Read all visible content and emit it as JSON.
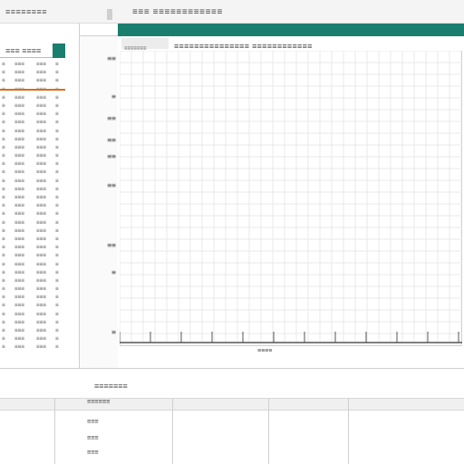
{
  "titlebar": {
    "left_text": "≡≡≡≡≡≡≡≡",
    "center_text": "≡≡≡ ≡≡≡≡≡≡≡≡≡≡≡≡"
  },
  "left_table": {
    "header_label": "≡≡≡ ≡≡≡≡",
    "rows": [
      [
        "≡",
        "≡≡≡",
        "≡≡≡",
        "≡"
      ],
      [
        "≡",
        "≡≡≡",
        "≡≡≡",
        "≡"
      ],
      [
        "≡",
        "≡≡≡",
        "≡≡≡",
        "≡"
      ],
      [
        "≡",
        "≡≡≡",
        "≡≡≡",
        "≡"
      ],
      [
        "≡",
        "≡≡≡",
        "≡≡≡",
        "≡"
      ],
      [
        "≡",
        "≡≡≡",
        "≡≡≡",
        "≡"
      ],
      [
        "≡",
        "≡≡≡",
        "≡≡≡",
        "≡"
      ],
      [
        "≡",
        "≡≡≡",
        "≡≡≡",
        "≡"
      ],
      [
        "≡",
        "≡≡≡",
        "≡≡≡",
        "≡"
      ],
      [
        "≡",
        "≡≡≡",
        "≡≡≡",
        "≡"
      ],
      [
        "≡",
        "≡≡≡",
        "≡≡≡",
        "≡"
      ],
      [
        "≡",
        "≡≡≡",
        "≡≡≡",
        "≡"
      ],
      [
        "≡",
        "≡≡≡",
        "≡≡≡",
        "≡"
      ],
      [
        "≡",
        "≡≡≡",
        "≡≡≡",
        "≡"
      ],
      [
        "≡",
        "≡≡≡",
        "≡≡≡",
        "≡"
      ],
      [
        "≡",
        "≡≡≡",
        "≡≡≡",
        "≡"
      ],
      [
        "≡",
        "≡≡≡",
        "≡≡≡",
        "≡"
      ],
      [
        "≡",
        "≡≡≡",
        "≡≡≡",
        "≡"
      ],
      [
        "≡",
        "≡≡≡",
        "≡≡≡",
        "≡"
      ],
      [
        "≡",
        "≡≡≡",
        "≡≡≡",
        "≡"
      ],
      [
        "≡",
        "≡≡≡",
        "≡≡≡",
        "≡"
      ],
      [
        "≡",
        "≡≡≡",
        "≡≡≡",
        "≡"
      ],
      [
        "≡",
        "≡≡≡",
        "≡≡≡",
        "≡"
      ],
      [
        "≡",
        "≡≡≡",
        "≡≡≡",
        "≡"
      ],
      [
        "≡",
        "≡≡≡",
        "≡≡≡",
        "≡"
      ],
      [
        "≡",
        "≡≡≡",
        "≡≡≡",
        "≡"
      ],
      [
        "≡",
        "≡≡≡",
        "≡≡≡",
        "≡"
      ],
      [
        "≡",
        "≡≡≡",
        "≡≡≡",
        "≡"
      ],
      [
        "≡",
        "≡≡≡",
        "≡≡≡",
        "≡"
      ],
      [
        "≡",
        "≡≡≡",
        "≡≡≡",
        "≡"
      ],
      [
        "≡",
        "≡≡≡",
        "≡≡≡",
        "≡"
      ],
      [
        "≡",
        "≡≡≡",
        "≡≡≡",
        "≡"
      ],
      [
        "≡",
        "≡≡≡",
        "≡≡≡",
        "≡"
      ],
      [
        "≡",
        "≡≡≡",
        "≡≡≡",
        "≡"
      ],
      [
        "≡",
        "≡≡≡",
        "≡≡≡",
        "≡"
      ]
    ]
  },
  "chart_panel": {
    "sub_left_label": "≡≡≡≡≡≡≡",
    "title": "≡≡≡≡≡≡≡≡≡≡≡≡≡≡≡  ≡≡≡≡≡≡≡≡≡≡≡≡",
    "x_axis_label": "≡≡≡≡",
    "y_ticks": [
      "≡≡",
      "≡",
      "≡≡",
      "≡≡",
      "≡≡",
      "≡≡",
      "≡≡",
      "≡",
      "≡"
    ]
  },
  "bottom_panel": {
    "section_label": "≡≡≡≡≡≡≡",
    "cells": [
      "≡≡≡≡≡≡",
      "≡≡≡",
      "≡≡≡",
      "≡≡≡"
    ]
  },
  "colors": {
    "accent_teal": "#1a7e6e",
    "accent_orange": "#e06a1a"
  },
  "chart_data": {
    "type": "line",
    "title": "",
    "xlabel": "",
    "ylabel": "",
    "series": [],
    "grid": true
  }
}
